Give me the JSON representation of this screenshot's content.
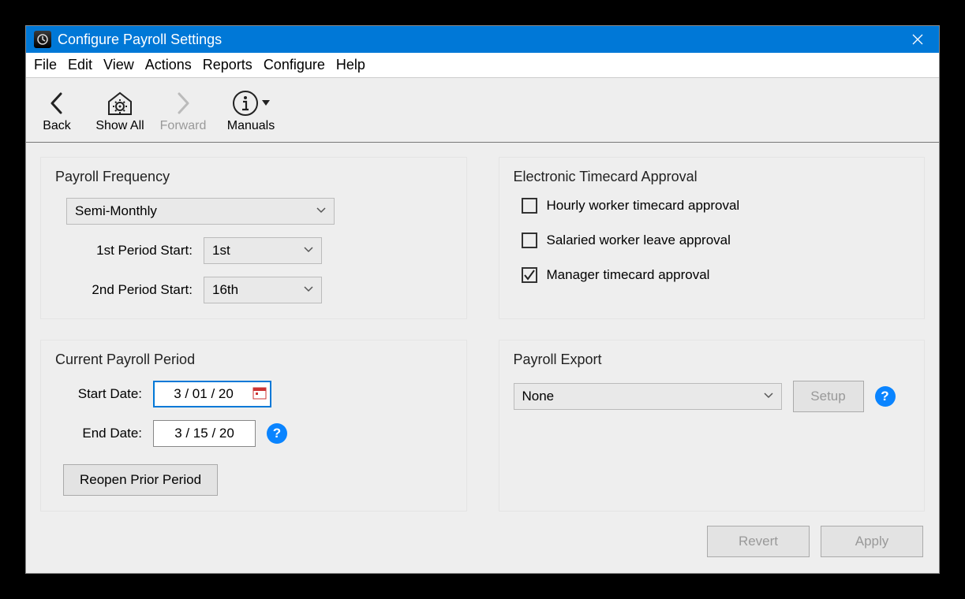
{
  "window": {
    "title": "Configure Payroll Settings"
  },
  "menubar": [
    "File",
    "Edit",
    "View",
    "Actions",
    "Reports",
    "Configure",
    "Help"
  ],
  "toolbar": {
    "back": "Back",
    "showAll": "Show All",
    "forward": "Forward",
    "manuals": "Manuals"
  },
  "groups": {
    "frequency": {
      "title": "Payroll Frequency",
      "type_value": "Semi-Monthly",
      "first_label": "1st Period Start:",
      "first_value": "1st",
      "second_label": "2nd Period Start:",
      "second_value": "16th"
    },
    "approval": {
      "title": "Electronic Timecard Approval",
      "hourly": {
        "label": "Hourly worker timecard approval",
        "checked": false
      },
      "salaried": {
        "label": "Salaried worker leave approval",
        "checked": false
      },
      "manager": {
        "label": "Manager timecard approval",
        "checked": true
      }
    },
    "current": {
      "title": "Current Payroll Period",
      "start_label": "Start Date:",
      "start_value": "3 / 01 / 20",
      "end_label": "End Date:",
      "end_value": "3 / 15 / 20",
      "reopen": "Reopen Prior Period"
    },
    "export": {
      "title": "Payroll Export",
      "value": "None",
      "setup": "Setup"
    }
  },
  "footer": {
    "revert": "Revert",
    "apply": "Apply"
  }
}
